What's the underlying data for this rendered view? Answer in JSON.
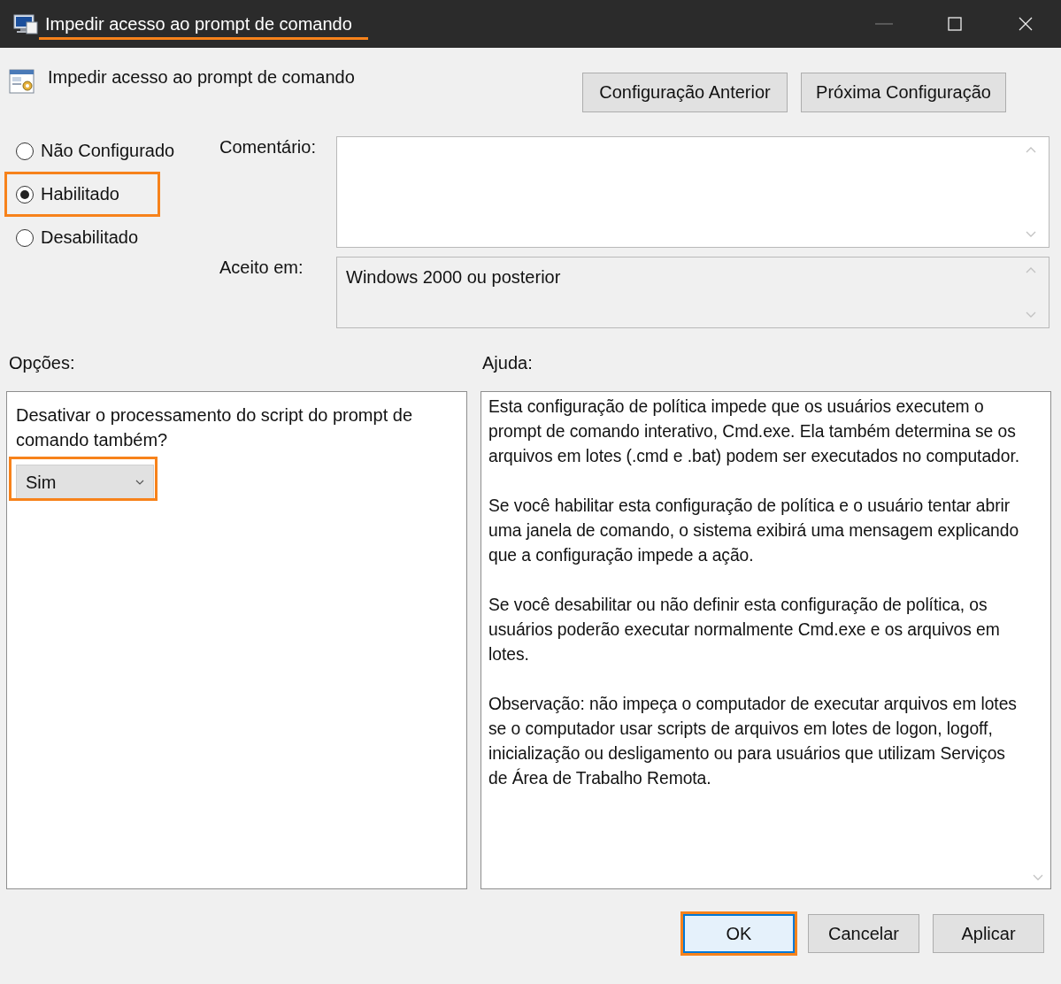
{
  "window": {
    "title": "Impedir acesso ao prompt de comando",
    "title_highlighted": true
  },
  "header": {
    "title": "Impedir acesso ao prompt de comando"
  },
  "nav_buttons": [
    {
      "label": "Configuração Anterior"
    },
    {
      "label": "Próxima Configuração"
    }
  ],
  "state_options": [
    {
      "label": "Não Configurado",
      "selected": false,
      "highlighted": false
    },
    {
      "label": "Habilitado",
      "selected": true,
      "highlighted": true
    },
    {
      "label": "Desabilitado",
      "selected": false,
      "highlighted": false
    }
  ],
  "comment": {
    "label": "Comentário:"
  },
  "supported_on": {
    "label": "Aceito em:",
    "value": "Windows 2000 ou posterior"
  },
  "options": {
    "label": "Opções:",
    "items": [
      {
        "kind": "dropdown",
        "label": "Desativar o processamento do script do prompt de comando também?",
        "value": "Sim",
        "highlighted": true
      }
    ]
  },
  "help": {
    "label": "Ajuda:",
    "paragraphs": [
      "Esta configuração de política impede que os usuários executem o prompt de comando interativo, Cmd.exe.  Ela também determina se os arquivos em lotes (.cmd e .bat) podem ser executados no computador.",
      "Se você habilitar esta configuração de política e o usuário tentar abrir uma janela de comando, o sistema exibirá uma mensagem explicando que a configuração impede a ação.",
      "Se você desabilitar ou não definir esta configuração de política, os usuários poderão executar normalmente Cmd.exe e os arquivos em lotes.",
      "Observação: não impeça o computador de executar arquivos em lotes se o computador usar scripts de arquivos em lotes de logon, logoff, inicialização ou desligamento ou para usuários que utilizam Serviços de Área de Trabalho Remota."
    ]
  },
  "buttons": [
    {
      "label": "OK",
      "default": true,
      "highlighted": true
    },
    {
      "label": "Cancelar",
      "default": false,
      "highlighted": false
    },
    {
      "label": "Aplicar",
      "default": false,
      "highlighted": false
    }
  ]
}
